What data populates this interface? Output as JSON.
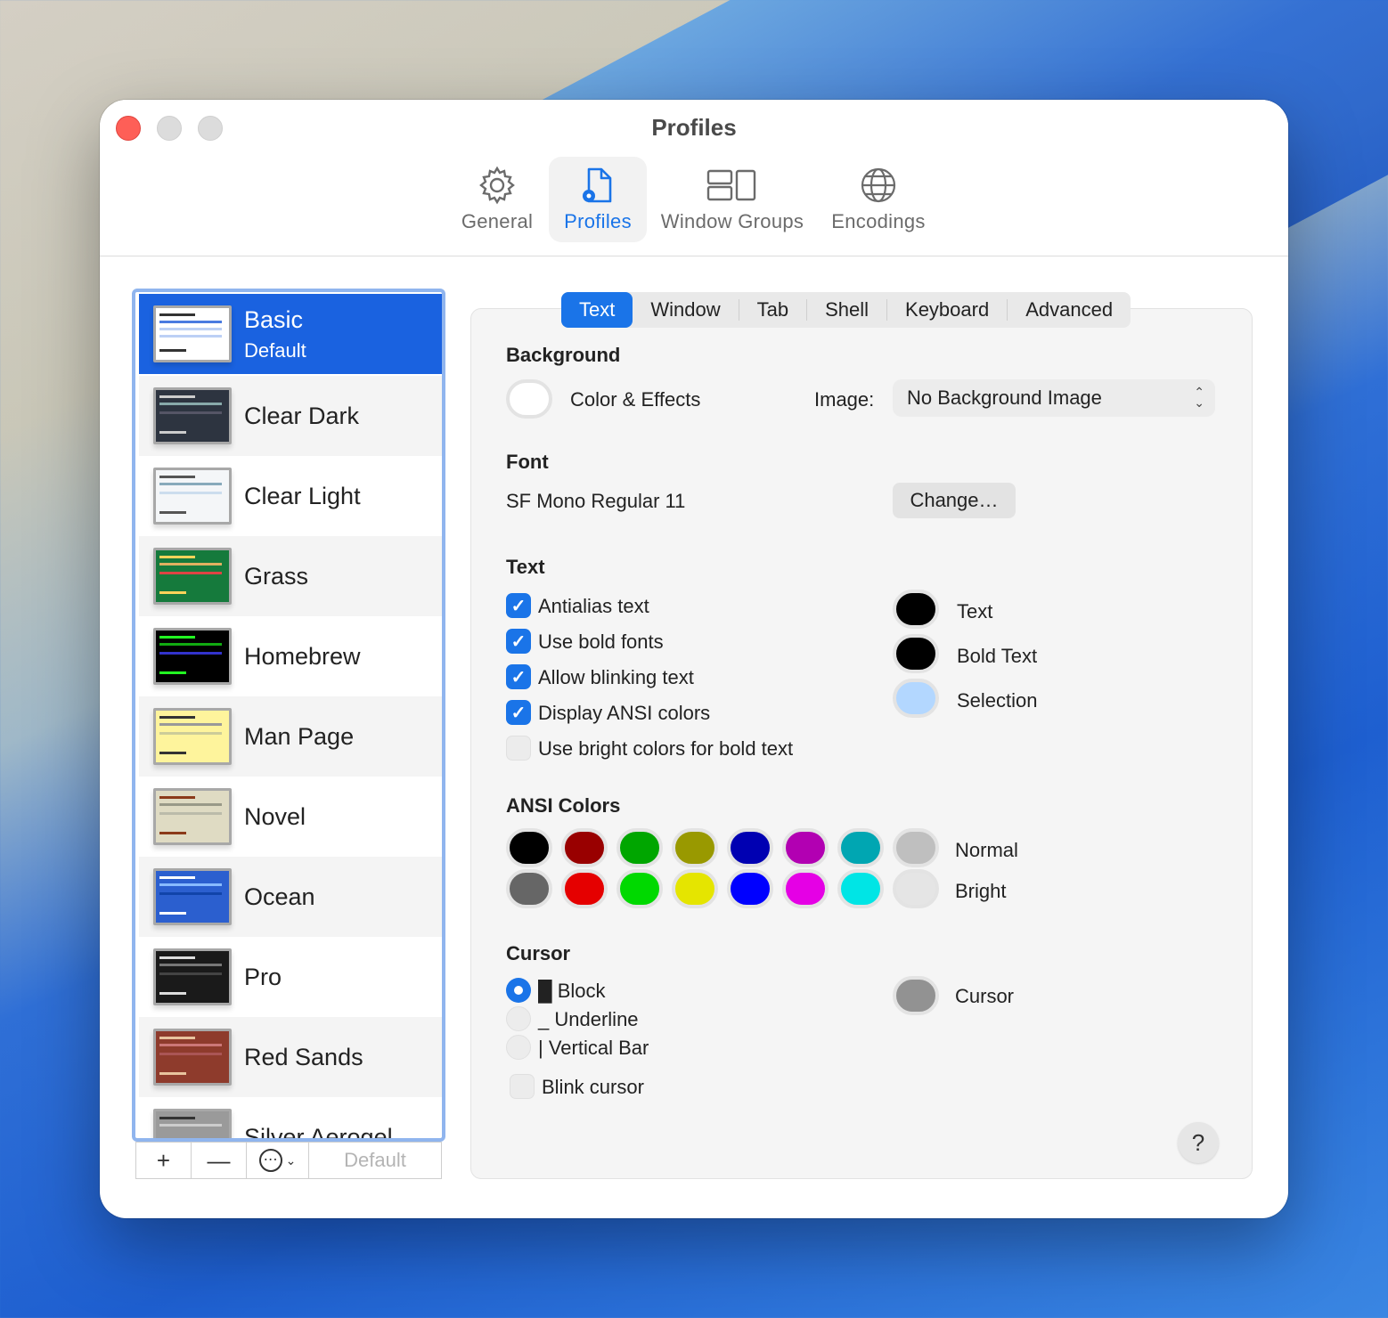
{
  "window": {
    "title": "Profiles"
  },
  "toolbar": {
    "items": [
      {
        "label": "General",
        "icon": "gear-icon"
      },
      {
        "label": "Profiles",
        "icon": "profile-document-icon"
      },
      {
        "label": "Window Groups",
        "icon": "window-groups-icon"
      },
      {
        "label": "Encodings",
        "icon": "globe-icon"
      }
    ],
    "active": "Profiles"
  },
  "profiles": {
    "items": [
      {
        "name": "Basic",
        "subtitle": "Default"
      },
      {
        "name": "Clear Dark"
      },
      {
        "name": "Clear Light"
      },
      {
        "name": "Grass"
      },
      {
        "name": "Homebrew"
      },
      {
        "name": "Man Page"
      },
      {
        "name": "Novel"
      },
      {
        "name": "Ocean"
      },
      {
        "name": "Pro"
      },
      {
        "name": "Red Sands"
      },
      {
        "name": "Silver Aerogel"
      }
    ],
    "selected": "Basic",
    "controls": {
      "add": "+",
      "remove": "—",
      "more": "⋯",
      "default_label": "Default"
    }
  },
  "tabs": {
    "items": [
      "Text",
      "Window",
      "Tab",
      "Shell",
      "Keyboard",
      "Advanced"
    ],
    "active": "Text"
  },
  "background": {
    "title": "Background",
    "color_effects_label": "Color & Effects",
    "image_label": "Image:",
    "image_value": "No Background Image"
  },
  "font": {
    "title": "Font",
    "value": "SF Mono Regular 11",
    "change_label": "Change…"
  },
  "text": {
    "title": "Text",
    "options": [
      {
        "label": "Antialias text",
        "checked": true
      },
      {
        "label": "Use bold fonts",
        "checked": true
      },
      {
        "label": "Allow blinking text",
        "checked": true
      },
      {
        "label": "Display ANSI colors",
        "checked": true
      },
      {
        "label": "Use bright colors for bold text",
        "checked": false
      }
    ],
    "colors": [
      {
        "label": "Text",
        "color": "#000000"
      },
      {
        "label": "Bold Text",
        "color": "#000000"
      },
      {
        "label": "Selection",
        "color": "#b3d7ff"
      }
    ]
  },
  "ansi": {
    "title": "ANSI Colors",
    "normal_label": "Normal",
    "bright_label": "Bright",
    "normal": [
      "#000000",
      "#990000",
      "#00a600",
      "#999900",
      "#0000b2",
      "#b200b2",
      "#00a6b2",
      "#bfbfbf"
    ],
    "bright": [
      "#666666",
      "#e50000",
      "#00d900",
      "#e5e500",
      "#0000ff",
      "#e500e5",
      "#00e5e5",
      "#e5e5e5"
    ]
  },
  "cursor": {
    "title": "Cursor",
    "options": [
      {
        "glyph": "█",
        "label": "Block",
        "selected": true
      },
      {
        "glyph": "_",
        "label": "Underline",
        "selected": false
      },
      {
        "glyph": "|",
        "label": "Vertical Bar",
        "selected": false
      }
    ],
    "blink_label": "Blink cursor",
    "blink_checked": false,
    "color_label": "Cursor",
    "color": "#929292"
  },
  "help_label": "?"
}
